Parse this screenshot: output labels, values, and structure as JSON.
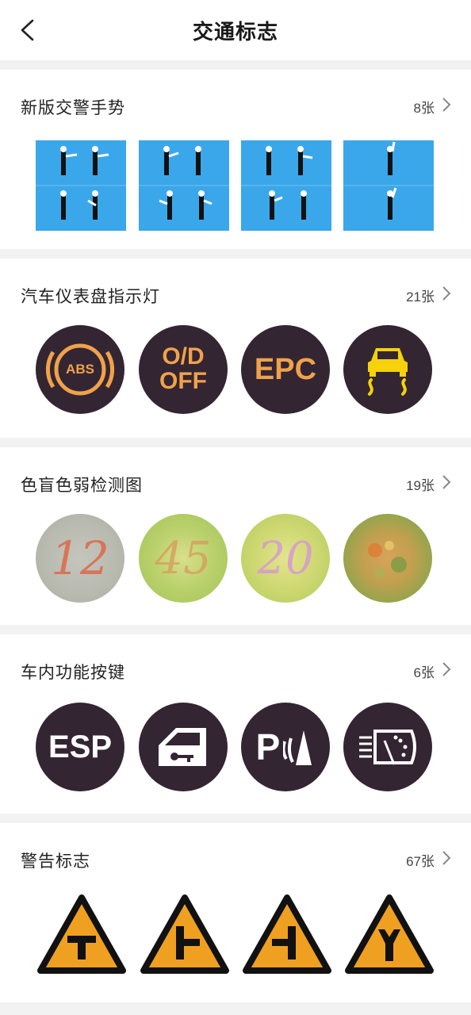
{
  "header": {
    "title": "交通标志",
    "back_icon": "chevron-left-icon"
  },
  "sections": [
    {
      "title": "新版交警手势",
      "count": "8张",
      "thumbnails": [
        "traffic-police-gesture-1",
        "traffic-police-gesture-2",
        "traffic-police-gesture-3",
        "traffic-police-gesture-4"
      ]
    },
    {
      "title": "汽车仪表盘指示灯",
      "count": "21张",
      "thumbnails": [
        "abs-warning-icon",
        "od-off-icon",
        "epc-icon",
        "traction-control-icon"
      ],
      "labels": {
        "abs": "ABS",
        "od_line1": "O/D",
        "od_line2": "OFF",
        "epc": "EPC"
      }
    },
    {
      "title": "色盲色弱检测图",
      "count": "19张",
      "thumbnails": [
        "color-plate-12",
        "color-plate-45",
        "color-plate-20",
        "color-plate-hidden"
      ],
      "labels": {
        "p1": "12",
        "p2": "45",
        "p3": "20"
      }
    },
    {
      "title": "车内功能按键",
      "count": "6张",
      "thumbnails": [
        "esp-icon",
        "door-key-icon",
        "parking-sensor-icon",
        "rear-wiper-icon"
      ],
      "labels": {
        "esp": "ESP",
        "park": "P"
      }
    },
    {
      "title": "警告标志",
      "count": "67张",
      "thumbnails": [
        "t-junction-sign",
        "left-side-junction-sign",
        "right-side-junction-sign",
        "y-junction-sign"
      ]
    }
  ],
  "colors": {
    "gesture_bg": "#3aa7ea",
    "badge_bg": "#342533",
    "badge_orange": "#f0a24a",
    "badge_yellow": "#f5d20a",
    "warning_orange": "#f0a020"
  }
}
